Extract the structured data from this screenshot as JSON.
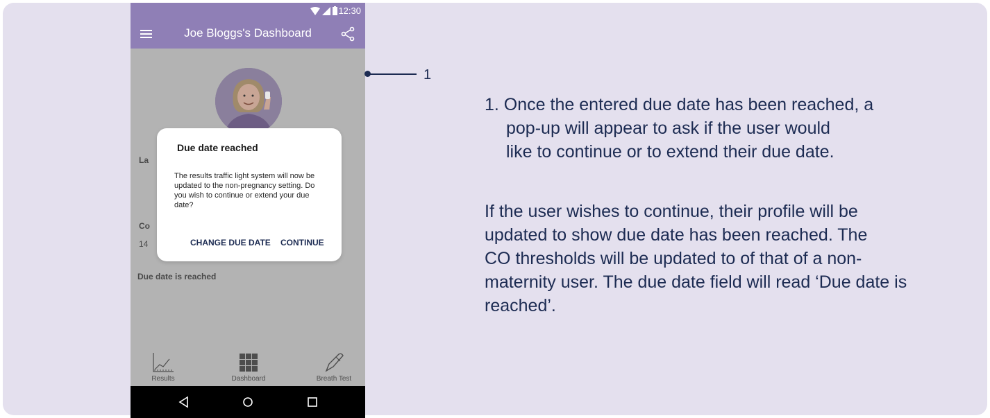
{
  "colors": {
    "accent": "#8f7fb6",
    "panel": "#e4e0ee",
    "navy": "#1c2b52",
    "overlay": "#b3b3b3"
  },
  "status_bar": {
    "time": "12:30",
    "icons": [
      "wifi-icon",
      "signal-icon",
      "battery-icon"
    ]
  },
  "app_bar": {
    "title": "Joe Bloggs's Dashboard",
    "left_icon": "menu-icon",
    "right_icon": "share-icon"
  },
  "background": {
    "last_label": "La",
    "co_label": "Co",
    "co_value": "14",
    "due_date_status": "Due date is reached"
  },
  "dialog": {
    "title": "Due date reached",
    "body": "The results traffic light system will now be updated to the non-pregnancy setting. Do you wish to continue or extend your due date?",
    "change_label": "CHANGE DUE DATE",
    "continue_label": "CONTINUE"
  },
  "bottom_nav": [
    {
      "label": "Results",
      "icon": "chart-icon"
    },
    {
      "label": "Dashboard",
      "icon": "grid-icon"
    },
    {
      "label": "Breath Test",
      "icon": "pen-icon"
    }
  ],
  "system_nav": [
    "back-icon",
    "home-icon",
    "recents-icon"
  ],
  "annotation": {
    "callout_number": "1",
    "note_1_lines": [
      "1. Once the entered due date has been reached, a",
      "pop-up will appear to ask if the user would",
      "like to continue or to extend their due date."
    ],
    "note_2_lines": [
      "If the user wishes to continue, their profile will be",
      "updated to show due date has been reached. The",
      "CO thresholds will be updated to of that of a non-",
      "maternity user. The due date field will read ‘Due date is",
      "reached’."
    ]
  }
}
